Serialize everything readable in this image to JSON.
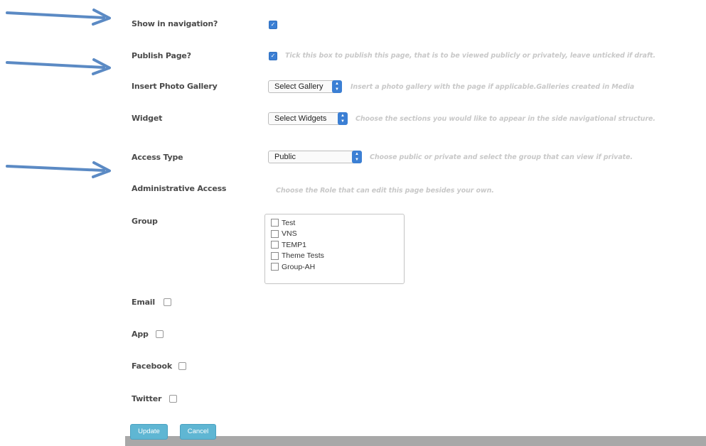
{
  "form": {
    "show_in_navigation": {
      "label": "Show in navigation?",
      "checked": true
    },
    "publish_page": {
      "label": "Publish Page?",
      "checked": true,
      "help": "Tick this box to publish this page, that is to be viewed publicly or privately, leave unticked if draft."
    },
    "photo_gallery": {
      "label": "Insert Photo Gallery",
      "selected": "Select Gallery",
      "help": "Insert a photo gallery with the page if applicable.Galleries created in Media"
    },
    "widget": {
      "label": "Widget",
      "selected": "Select Widgets",
      "help": "Choose the sections you would like to appear in the side navigational structure."
    },
    "access_type": {
      "label": "Access Type",
      "selected": "Public",
      "help": "Choose public or private and select the group that can view if private."
    },
    "admin_access": {
      "label": "Administrative Access",
      "help": "Choose the Role that can edit this page besides your own."
    },
    "group": {
      "label": "Group",
      "options": [
        "Test",
        "VNS",
        "TEMP1",
        "Theme Tests",
        "Group-AH"
      ]
    },
    "email": {
      "label": "Email",
      "checked": false
    },
    "app": {
      "label": "App",
      "checked": false
    },
    "facebook": {
      "label": "Facebook",
      "checked": false
    },
    "twitter": {
      "label": "Twitter",
      "checked": false
    }
  },
  "buttons": {
    "update": "Update",
    "cancel": "Cancel"
  },
  "colors": {
    "accent": "#3b7fd4",
    "button": "#5fb6d3",
    "arrow": "#5b8ac4"
  },
  "icons": {
    "annotation": "arrow-right-icon",
    "checkmark": "check-icon",
    "select": "chevron-updown-icon"
  }
}
